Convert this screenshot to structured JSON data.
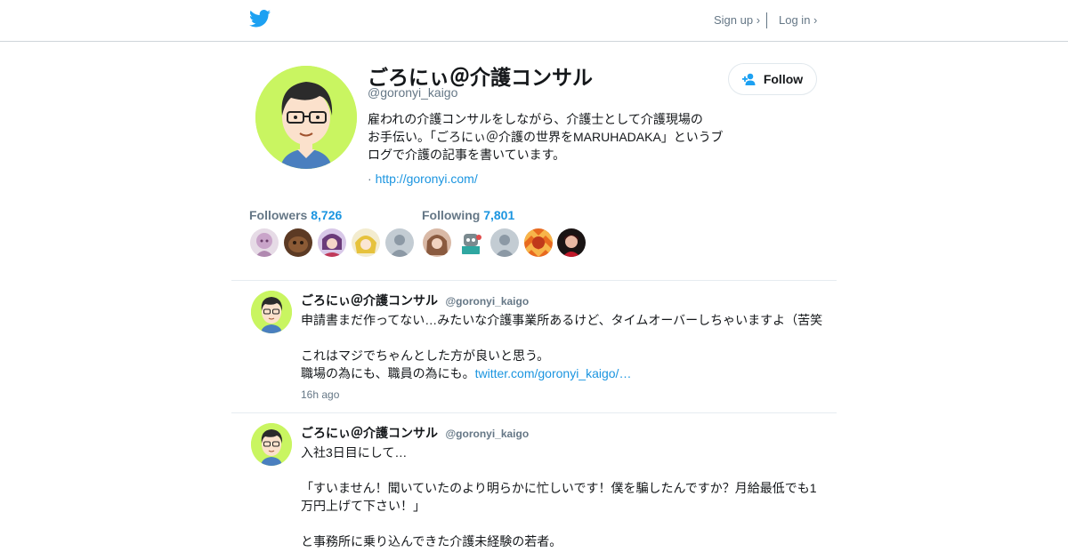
{
  "nav": {
    "signup": "Sign up ›",
    "login": "Log in ›"
  },
  "profile": {
    "name": "ごろにぃ＠介護コンサル",
    "handle": "@goronyi_kaigo",
    "bio": "雇われの介護コンサルをしながら、介護士として介護現場の\nお手伝い。「ごろにぃ＠介護の世界をMARUHADAKA」というブ\nログで介護の記事を書いています。",
    "url_prefix": "·",
    "url": "http://goronyi.com/",
    "follow_label": "Follow"
  },
  "stats": {
    "followers_label": "Followers",
    "followers_count": "8,726",
    "following_label": "Following",
    "following_count": "7,801"
  },
  "tweets": [
    {
      "name": "ごろにぃ＠介護コンサル",
      "handle": "@goronyi_kaigo",
      "line1": "申請書まだ作ってない…みたいな介護事業所あるけど、タイムオーバーしちゃいますよ（苦笑",
      "line2": "これはマジでちゃんとした方が良いと思う。",
      "line3": "職場の為にも、職員の為にも。",
      "link": "twitter.com/goronyi_kaigo/…",
      "time": "16h ago"
    },
    {
      "name": "ごろにぃ＠介護コンサル",
      "handle": "@goronyi_kaigo",
      "line1": "入社3日目にして…",
      "line2": "「すいません！聞いていたのより明らかに忙しいです！僕を騙したんですか？月給最低でも1万円上げて下さい！」",
      "line3": "と事務所に乗り込んできた介護未経験の若者。"
    }
  ],
  "colors": {
    "accent": "#1b95e0",
    "avatar_bg": "#c9f561",
    "muted": "#657786"
  }
}
